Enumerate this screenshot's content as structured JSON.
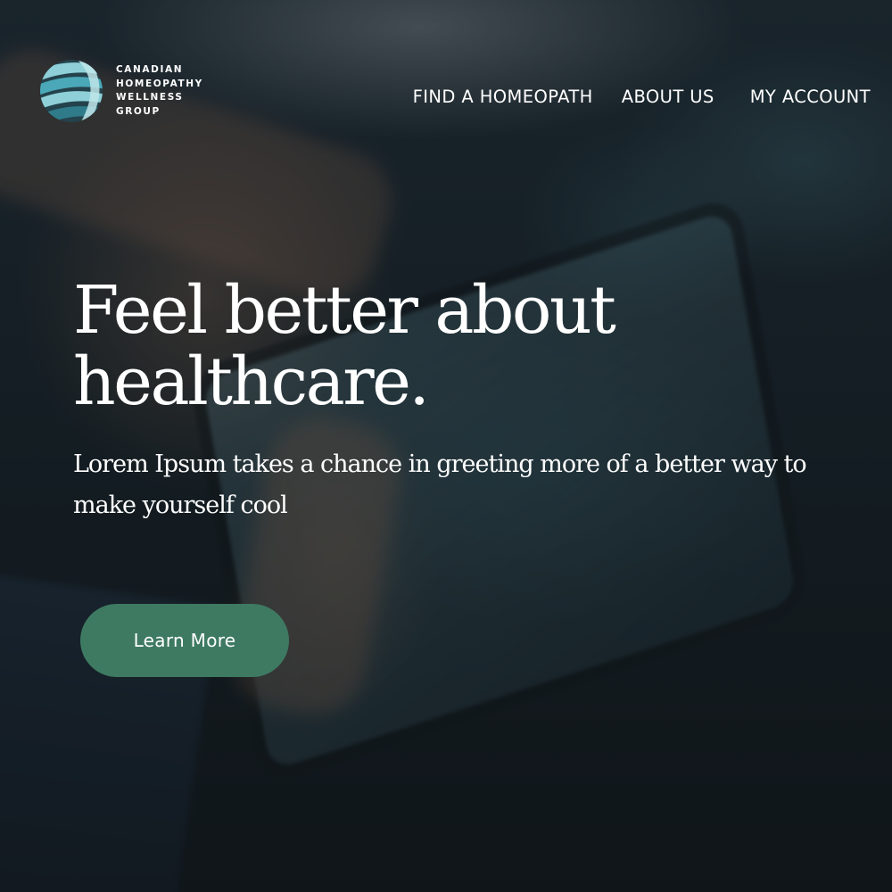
{
  "brand": {
    "name": "CANADIAN HOMEOPATHY WELLNESS GROUP",
    "logo_icon": "globe-stripes-logo",
    "colors": {
      "logo_light": "#8fd0d8",
      "logo_mid": "#4aa8b8",
      "logo_dark": "#2f7b8a"
    }
  },
  "nav": {
    "items": [
      {
        "label": "FIND A HOMEOPATH"
      },
      {
        "label": "ABOUT US"
      },
      {
        "label": "MY ACCOUNT"
      }
    ]
  },
  "hero": {
    "headline": "Feel better about healthcare.",
    "subtext": "Lorem Ipsum takes a chance in greeting more of a better way to make yourself cool",
    "cta_label": "Learn More",
    "cta_color": "#3e7a62"
  }
}
